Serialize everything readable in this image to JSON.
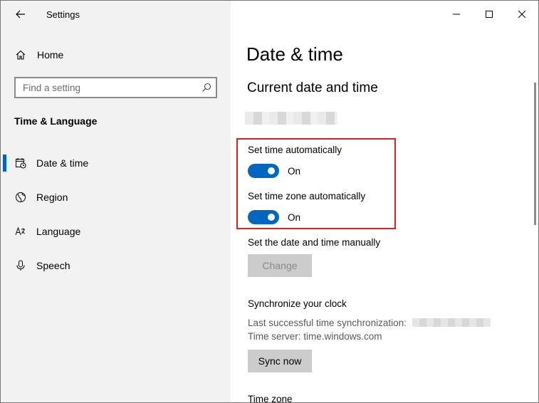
{
  "window": {
    "title": "Settings"
  },
  "sidebar": {
    "home_label": "Home",
    "search": {
      "placeholder": "Find a setting",
      "value": ""
    },
    "section_title": "Time & Language",
    "items": [
      {
        "label": "Date & time",
        "icon": "calendar-clock-icon",
        "active": true
      },
      {
        "label": "Region",
        "icon": "globe-icon",
        "active": false
      },
      {
        "label": "Language",
        "icon": "language-icon",
        "active": false
      },
      {
        "label": "Speech",
        "icon": "microphone-icon",
        "active": false
      }
    ]
  },
  "main": {
    "title": "Date & time",
    "subtitle": "Current date and time",
    "auto_time": {
      "label": "Set time automatically",
      "state": "On"
    },
    "auto_zone": {
      "label": "Set time zone automatically",
      "state": "On"
    },
    "manual": {
      "label": "Set the date and time manually",
      "button": "Change"
    },
    "sync": {
      "title": "Synchronize your clock",
      "last_sync_label": "Last successful time synchronization:",
      "time_server": "Time server: time.windows.com",
      "button": "Sync now"
    },
    "time_zone_label": "Time zone"
  },
  "colors": {
    "accent": "#0067c0",
    "highlight": "#e02020",
    "sidebar_bg": "#f2f2f2"
  }
}
